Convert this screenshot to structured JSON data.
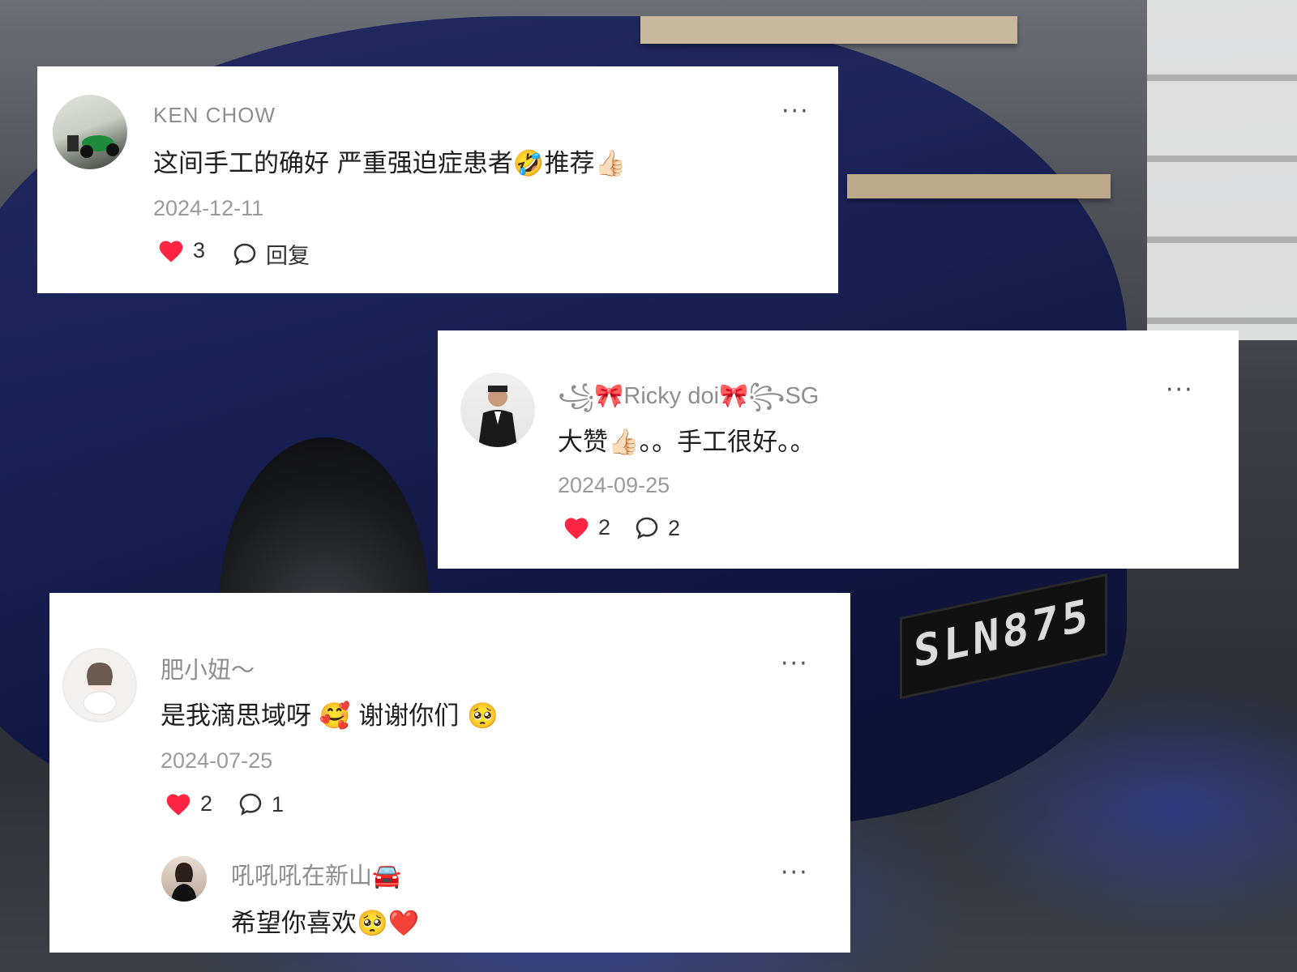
{
  "colors": {
    "heart": "#ff2442",
    "card_bg": "#ffffff",
    "muted_text": "#8e8e8e"
  },
  "background": {
    "plate_text": "SLN875"
  },
  "comments": [
    {
      "username": "KEN CHOW",
      "text": "这间手工的确好 严重强迫症患者🤣推荐👍🏻",
      "date": "2024-12-11",
      "likes": "3",
      "reply_label": "回复",
      "more": "···",
      "avatar_icon": "motorbike-photo-avatar"
    },
    {
      "username": "꧁🎀Ricky doi🎀꧂SG",
      "text": "大赞👍🏻。。手工很好。。",
      "date": "2024-09-25",
      "likes": "2",
      "replies": "2",
      "more": "···",
      "avatar_icon": "man-in-suit-avatar"
    },
    {
      "username": "肥小妞～",
      "text": "是我滴思域呀 🥰 谢谢你们 🥺",
      "date": "2024-07-25",
      "likes": "2",
      "replies": "1",
      "more": "···",
      "avatar_icon": "cartoon-girl-avatar",
      "reply": {
        "username": "吼吼吼在新山🚘",
        "text": "希望你喜欢🥺❤️",
        "more": "···",
        "avatar_icon": "woman-selfie-avatar"
      }
    }
  ]
}
